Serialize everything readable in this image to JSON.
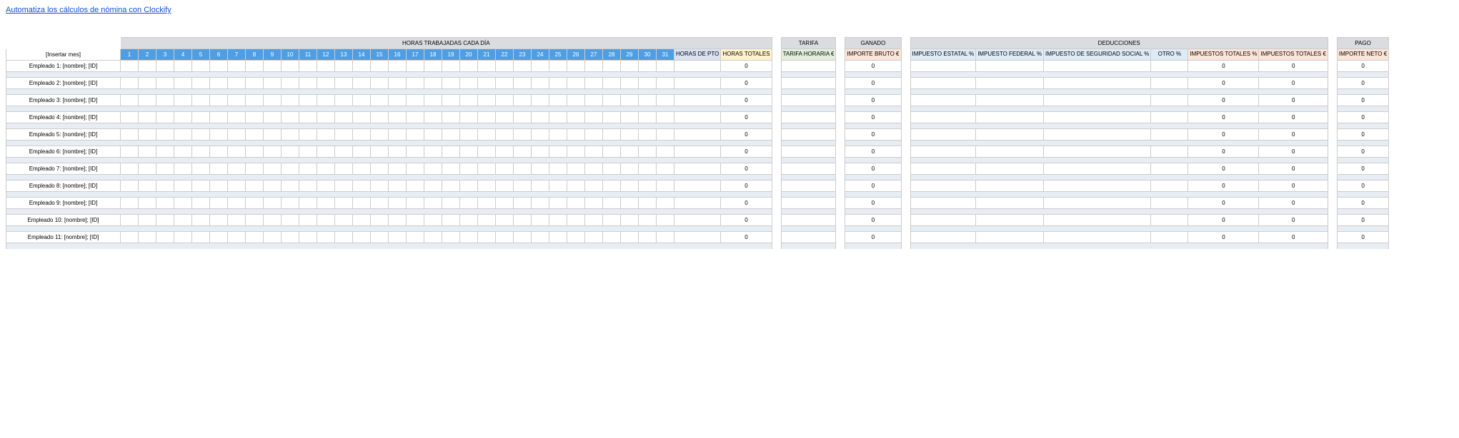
{
  "top_link": "Automatiza los cálculos de nómina con Clockify",
  "month_placeholder": "[Insertar mes]",
  "section_hours": "HORAS TRABAJADAS CADA DÍA",
  "section_tarifa": "TARIFA",
  "section_ganado": "GANADO",
  "section_deducciones": "DEDUCCIONES",
  "section_pago": "PAGO",
  "days": [
    "1",
    "2",
    "3",
    "4",
    "5",
    "6",
    "7",
    "8",
    "9",
    "10",
    "11",
    "12",
    "13",
    "14",
    "15",
    "16",
    "17",
    "18",
    "19",
    "20",
    "21",
    "22",
    "23",
    "24",
    "25",
    "26",
    "27",
    "28",
    "29",
    "30",
    "31"
  ],
  "hdr_pto": "HORAS DE PTO",
  "hdr_total_horas": "HORAS TOTALES",
  "hdr_tarifa": "TARIFA HORARIA\n€",
  "hdr_bruto": "IMPORTE BRUTO\n€",
  "hdr_imp_estatal": "IMPUESTO ESTATAL\n%",
  "hdr_imp_federal": "IMPUESTO FEDERAL\n%",
  "hdr_imp_ss": "IMPUESTO DE SEGURIDAD SOCIAL %",
  "hdr_otro": "OTRO\n%",
  "hdr_imp_tot_pct": "IMPUESTOS TOTALES\n%",
  "hdr_imp_tot_eur": "IMPUESTOS TOTALES\n€",
  "hdr_neto": "IMPORTE NETO\n€",
  "employees": [
    "Empleado 1: [nombre]; [ID]",
    "Empleado 2: [nombre]; [ID]",
    "Empleado 3: [nombre]; [ID]",
    "Empleado 4: [nombre]; [ID]",
    "Empleado 5: [nombre]; [ID]",
    "Empleado 6: [nombre]; [ID]",
    "Empleado 7: [nombre]; [ID]",
    "Empleado 8: [nombre]; [ID]",
    "Empleado 9: [nombre]; [ID]",
    "Empleado 10: [nombre]; [ID]",
    "Empleado 11: [nombre]; [ID]"
  ],
  "zero": "0"
}
